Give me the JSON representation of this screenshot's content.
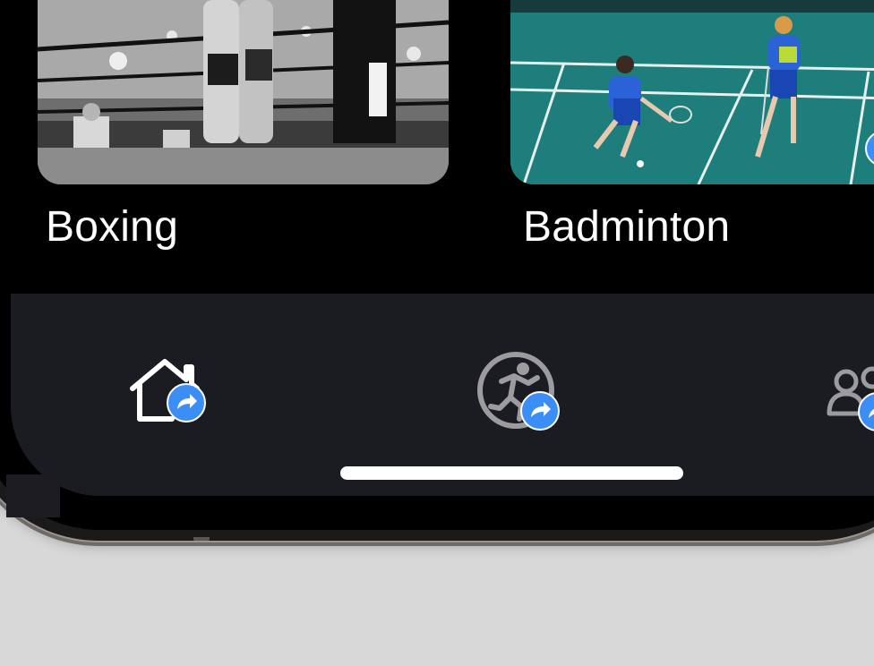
{
  "cards": [
    {
      "title": "Boxing",
      "image": "boxing-match-photo"
    },
    {
      "title": "Badminton",
      "image": "badminton-match-photo"
    }
  ],
  "tabs": [
    {
      "icon": "home-icon",
      "badge_icon": "share-arrow-icon"
    },
    {
      "icon": "sport-activity-icon",
      "badge_icon": "share-arrow-icon"
    },
    {
      "icon": "people-icon",
      "badge_icon": "share-arrow-icon"
    }
  ],
  "colors": {
    "accent": "#3a8ef6",
    "tab_bar_background": "#1b1c21",
    "screen_background": "#000000",
    "outer_background": "#d8d8d8"
  }
}
